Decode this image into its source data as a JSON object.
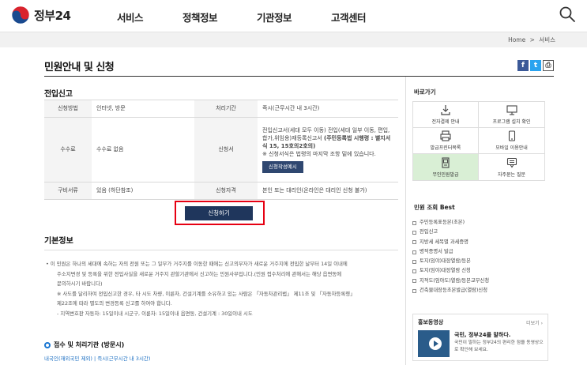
{
  "header": {
    "logo_text": "정부24",
    "nav": [
      "서비스",
      "정책정보",
      "기관정보",
      "고객센터"
    ]
  },
  "breadcrumb": {
    "home": "Home",
    "sep": ">",
    "current": "서비스"
  },
  "page": {
    "title": "민원안내 및 신청"
  },
  "share": {
    "facebook": "f",
    "twitter": "t",
    "print": "⎙"
  },
  "section": {
    "title": "전입신고",
    "rows": {
      "method_label": "신청방법",
      "method_value": "인터넷, 방문",
      "period_label": "처리기간",
      "period_value": "즉시(근무시간 내 3시간)",
      "fee_label": "수수료",
      "fee_value": "수수료 없음",
      "form_label": "신청서",
      "form_text1": "전입신고서(세대 모두 이동) 전입(세대 일부 이동, 편입,합가,위임용)재등록신고서 ",
      "form_bold": "(주민등록법 시행령 : 별지서식 15, 15호의2호의)",
      "form_text2": "※ 신청서식은 법령의 마지막 조항 밑에 있습니다.",
      "form_button": "신청작성예시",
      "docs_label": "구비서류",
      "docs_value": "있음 (하단참조)",
      "qual_label": "신청자격",
      "qual_value": "본인 또는 대리인(온라인은 대리인 신청 불가)"
    },
    "apply_button": "신청하기"
  },
  "basic": {
    "title": "기본정보",
    "lines": [
      "• 이 민원은 하나의 세대에 속하는 자의 전원 또는 그 일부가 거주지를 이동한 때에는 신고의무자가 새로운 거주지에 전입한 날부터 14일 이내에",
      "주소지변경 및 등록을 위한 전입사실을 새로운 거주지 관할기관에서 신고하는 민원사무입니다.(민원 접수처리에 관해서는 해당 읍면동에",
      "문의하시기 바랍니다)",
      "※ 사도를 달리하여 전입신고한 경우, 타 시도 차량, 이륜차, 건설기계를 소유하고 있는 사람은 「자동차관리법」 제11조 및 「자동차등록령」",
      "제22조에 따라 별도의 변경등록 신고를 하여야 합니다.",
      "- 지역변호판 자동차: 15일이내 시군구, 이륜차: 15일이내 읍면동, 건설기계 : 30일이내 시도"
    ],
    "process_title": "접수 및 처리기관 (방문시)",
    "process_sub": "내국인(재외국민 제외) | 즉시(근무시간 내 3시간)"
  },
  "sidebar": {
    "quick_title": "바로가기",
    "quick_items": [
      {
        "label": "전자결제 안내",
        "icon": "download-icon"
      },
      {
        "label": "프로그램 설치 확인",
        "icon": "monitor-icon"
      },
      {
        "label": "발급프린터목록",
        "icon": "printer-icon"
      },
      {
        "label": "모바일 이용안내",
        "icon": "mobile-icon"
      },
      {
        "label": "무인민원발급",
        "icon": "kiosk-icon"
      },
      {
        "label": "자주묻는 질문",
        "icon": "chat-icon"
      }
    ],
    "best_title": "민원 조회 Best",
    "best_items": [
      "주민등록표등본(초본)",
      "전입신고",
      "지방세 세목별 과세증명",
      "병적증명서 발급",
      "토지(임야)대장열람/등본",
      "토지(임야)대장열람 신청",
      "지적도(임야도)열람/등본교부신청",
      "건축물대장등초본발급(열람)신청"
    ],
    "promo_title": "홍보동영상",
    "promo_more": "더보기 ›",
    "promo_head": "국민, 정부24를 말하다.",
    "promo_text": "국민이 말하는 정부24의 편리한 점을 동영상으로 확인해 보세요."
  },
  "colors": {
    "accent": "#1f365c",
    "highlight": "#e60012",
    "active": "#d9efd5"
  }
}
